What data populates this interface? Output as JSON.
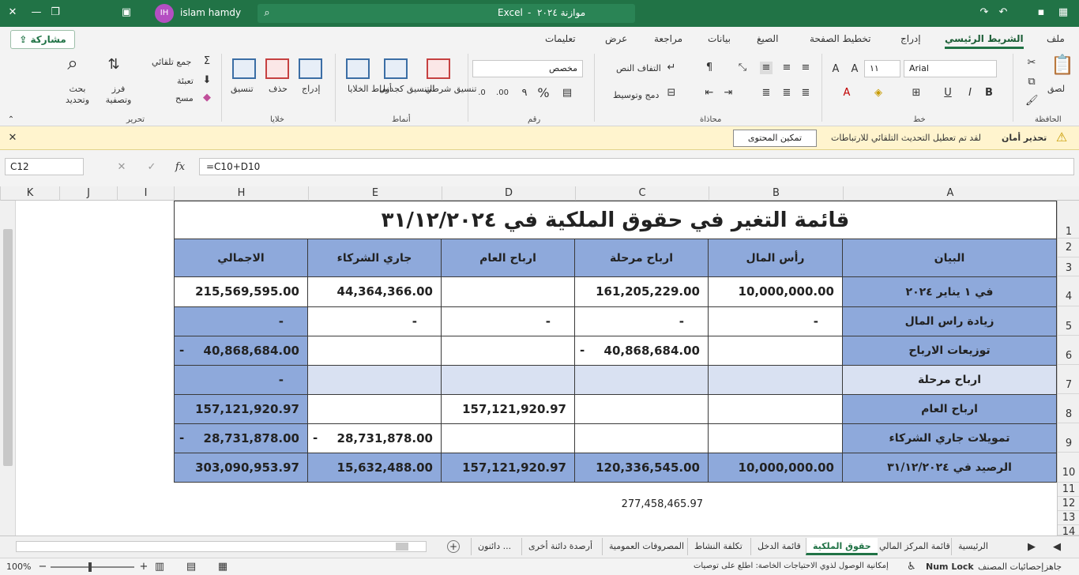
{
  "titlebar": {
    "user_initials": "IH",
    "user_name": "islam hamdy",
    "doc_title": "موازنة ٢٠٢٤",
    "app_name": "Excel",
    "separator": "-"
  },
  "menu": {
    "tabs": [
      "ملف",
      "الشريط الرئيسي",
      "إدراج",
      "تخطيط الصفحة",
      "الصيغ",
      "بيانات",
      "مراجعة",
      "عرض",
      "تعليمات"
    ],
    "share_label": "مشاركة"
  },
  "ribbon": {
    "clipboard": {
      "label": "الحافظة",
      "paste": "لصق"
    },
    "font": {
      "label": "خط",
      "name": "Arial",
      "size": "١١",
      "bold": "B",
      "italic": "I",
      "underline": "U"
    },
    "alignment": {
      "label": "محاذاة",
      "wrap": "التفاف النص",
      "merge": "دمج وتوسيط"
    },
    "number": {
      "label": "رقم",
      "format": "مخصص",
      "percent": "%",
      "comma": "٩"
    },
    "styles": {
      "label": "أنماط",
      "conditional": "تنسيق شرطي",
      "as_table": "التنسيق كجدول",
      "cell_styles": "أنماط الخلايا"
    },
    "cells": {
      "label": "خلايا",
      "insert": "إدراج",
      "delete": "حذف",
      "format": "تنسيق"
    },
    "editing": {
      "label": "تحرير",
      "autosum": "جمع تلقائي",
      "fill": "تعبئة",
      "clear": "مسح",
      "sort": "فرز وتصفية",
      "find": "بحث وتحديد"
    }
  },
  "warning": {
    "title": "تحذير أمان",
    "message": "لقد تم تعطيل التحديث التلقائي للارتباطات",
    "button": "تمكين المحتوى"
  },
  "formula": {
    "namebox": "C12",
    "content": "=C10+D10",
    "fx": "fx"
  },
  "columns": [
    "A",
    "B",
    "C",
    "D",
    "E",
    "H",
    "I",
    "J",
    "K"
  ],
  "rows": [
    "1",
    "2",
    "3",
    "4",
    "5",
    "6",
    "7",
    "8",
    "9",
    "10",
    "11",
    "12",
    "13",
    "14"
  ],
  "sheet": {
    "title": "قائمة التغير في حقوق الملكية في ٣١/١٢/٢٠٢٤",
    "headers": [
      "البيان",
      "رأس المال",
      "ارباح مرحلة",
      "ارباح العام",
      "جاري الشركاء",
      "الاجمالي"
    ],
    "rows": [
      {
        "label": "في ١ يناير ٢٠٢٤",
        "b": "10,000,000.00",
        "c": "161,205,229.00",
        "d": "",
        "e": "44,364,366.00",
        "h": "215,569,595.00"
      },
      {
        "label": "زيادة راس المال",
        "b": "-",
        "c": "-",
        "d": "-",
        "e": "-",
        "h": "-"
      },
      {
        "label": "توزيعات الارباح",
        "b": "",
        "c": "40,868,684.00",
        "d": "",
        "e": "",
        "h": "40,868,684.00",
        "c_neg": "-",
        "h_neg": "-"
      },
      {
        "label": "ارباح مرحلة",
        "b": "",
        "c": "",
        "d": "",
        "e": "",
        "h": "-"
      },
      {
        "label": "ارباح العام",
        "b": "",
        "c": "",
        "d": "157,121,920.97",
        "e": "",
        "h": "157,121,920.97"
      },
      {
        "label": "تمويلات جاري الشركاء",
        "b": "",
        "c": "",
        "d": "",
        "e": "28,731,878.00",
        "h": "28,731,878.00",
        "e_neg": "-",
        "h_neg": "-"
      },
      {
        "label": "الرصيد في ٣١/١٢/٢٠٢٤",
        "b": "10,000,000.00",
        "c": "120,336,545.00",
        "d": "157,121,920.97",
        "e": "15,632,488.00",
        "h": "303,090,953.97"
      }
    ],
    "extra_value": "277,458,465.97"
  },
  "tabs": [
    "الرئيسية",
    "قائمة المركز المالي",
    "حقوق الملكية",
    "قائمة الدخل",
    "تكلفة النشاط",
    "المصروفات العمومية",
    "أرصدة دائنة أخرى",
    "دائنون ..."
  ],
  "status": {
    "ready": "جاهز",
    "stats": "إحصائيات المصنف",
    "numlock": "Num Lock",
    "accessibility": "إمكانية الوصول لذوي الاحتياجات الخاصة: اطلع على توصيات",
    "zoom": "100%"
  },
  "colors": {
    "accent": "#217346",
    "table_blue": "#8ea9db",
    "table_light": "#d9e1f2",
    "warning_bg": "#fff4ce"
  }
}
